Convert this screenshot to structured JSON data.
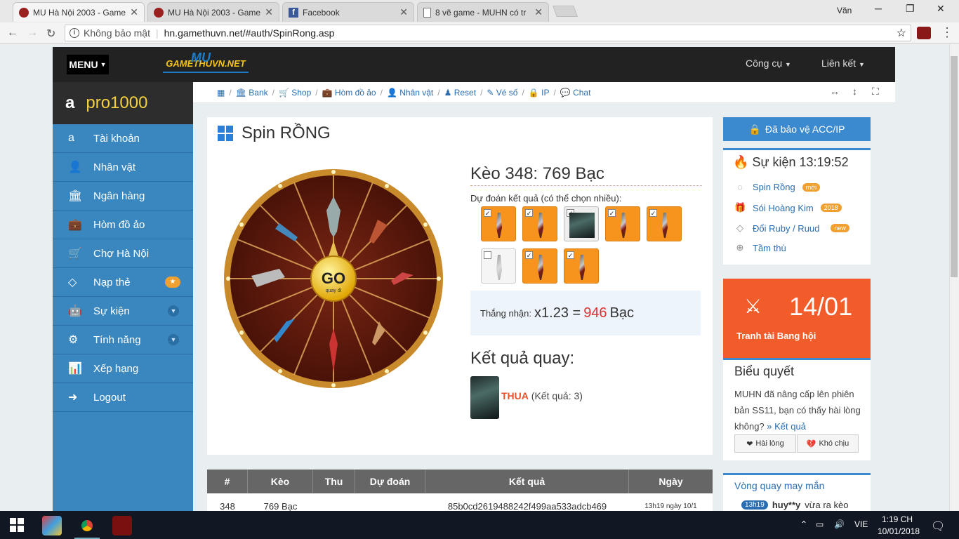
{
  "browser": {
    "tabs": [
      {
        "title": "MU Hà Nội 2003 - Game"
      },
      {
        "title": "MU Hà Nội 2003 - Game"
      },
      {
        "title": "Facebook"
      },
      {
        "title": "8 vẽ game - MUHN có tr"
      }
    ],
    "user": "Văn",
    "security_label": "Không bảo mật",
    "url": "hn.gamethuvn.net/#auth/SpinRong.asp"
  },
  "topnav": {
    "menu": "MENU",
    "logo": "GAMETHUVN.NET",
    "logo_big": "MU",
    "tools": "Công cụ",
    "links": "Liên kết"
  },
  "sidebar": {
    "username": "pro1000",
    "items": [
      {
        "label": "Tài khoản",
        "icon": "amazon-icon"
      },
      {
        "label": "Nhân vật",
        "icon": "user-icon"
      },
      {
        "label": "Ngân hàng",
        "icon": "bank-icon"
      },
      {
        "label": "Hòm đồ ảo",
        "icon": "briefcase-icon"
      },
      {
        "label": "Chợ Hà Nội",
        "icon": "cart-icon"
      },
      {
        "label": "Nạp thẻ",
        "icon": "diamond-icon"
      },
      {
        "label": "Sự kiện",
        "icon": "android-icon"
      },
      {
        "label": "Tính năng",
        "icon": "gears-icon"
      },
      {
        "label": "Xếp hạng",
        "icon": "bar-chart-icon"
      },
      {
        "label": "Logout",
        "icon": "sign-out-icon"
      }
    ],
    "star_badge": "★"
  },
  "breadcrumb": [
    "Bank",
    "Shop",
    "Hòm đồ ảo",
    "Nhân vật",
    "Reset",
    "Vé số",
    "IP",
    "Chat"
  ],
  "spin": {
    "title": "Spin RỒNG",
    "go": "GO",
    "go_sub": "quay đi",
    "keo": "Kèo 348: 769 Bạc",
    "predict_label": "Dự đoán kết quả (có thể chọn nhiều):",
    "items": [
      {
        "checked": true
      },
      {
        "checked": true
      },
      {
        "checked": true
      },
      {
        "checked": true
      },
      {
        "checked": true
      },
      {
        "checked": false
      },
      {
        "checked": true
      },
      {
        "checked": true
      }
    ],
    "win_label": "Thắng nhận:",
    "multiplier": "x1.23 =",
    "win_amount": "946",
    "currency": "Bạc",
    "result_title": "Kết quả quay:",
    "result_status": "THUA",
    "result_detail": "(Kết quả: 3)"
  },
  "table": {
    "headers": [
      "#",
      "Kèo",
      "Thu",
      "Dự đoán",
      "Kết quả",
      "Ngày"
    ],
    "rows": [
      [
        "348",
        "769 Bạc",
        "",
        "",
        "85b0cd2619488242f499aa533adcb469",
        "13h19 ngày 10/1"
      ]
    ]
  },
  "right": {
    "protect": "Đã bảo vệ ACC/IP",
    "event_title": "Sự kiện 13:19:52",
    "events": [
      {
        "label": "Spin Rồng",
        "badge": "mới",
        "badge_color": "#f0a030"
      },
      {
        "label": "Sói Hoàng Kim",
        "badge": "2018",
        "badge_color": "#f0a030"
      },
      {
        "label": "Đổi Ruby / Ruud",
        "badge": "new",
        "badge_color": "#f0a030"
      },
      {
        "label": "Tầm thù",
        "badge": ""
      }
    ],
    "countdown_date": "14/01",
    "countdown_label": "Tranh tài Bang hội",
    "vote_title": "Biểu quyết",
    "vote_text": "MUHN đã nâng cấp lên phiên bản SS11, bạn có thấy hài lòng không?",
    "vote_link": "» Kết quả",
    "vote_yes": "Hài lòng",
    "vote_no": "Khó chịu",
    "lucky_title": "Vòng quay may mắn",
    "lucky_time": "13h19",
    "lucky_user": "huy**y",
    "lucky_action": "vừa ra kèo"
  },
  "taskbar": {
    "lang": "VIE",
    "time": "1:19 CH",
    "date": "10/01/2018"
  }
}
